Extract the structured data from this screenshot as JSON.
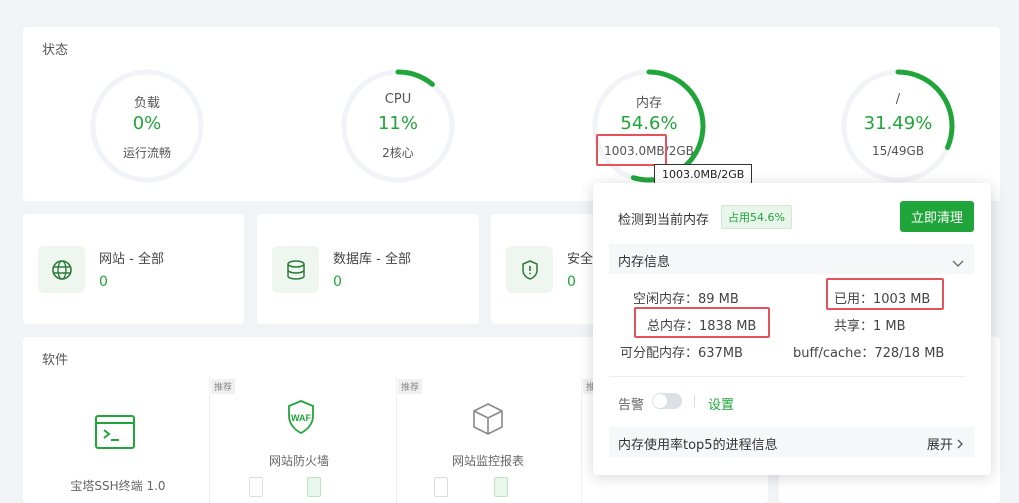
{
  "status": {
    "title": "状态",
    "gauges": [
      {
        "label": "负载",
        "value": "0%",
        "sub": "运行流畅",
        "fraction": 0.0
      },
      {
        "label": "CPU",
        "value": "11%",
        "sub": "2核心",
        "fraction": 0.11
      },
      {
        "label": "内存",
        "value": "54.6%",
        "sub": "1003.0MB/2GB",
        "fraction": 0.546
      },
      {
        "label": "/",
        "value": "31.49%",
        "sub": "15/49GB",
        "fraction": 0.3149
      }
    ],
    "tooltip": "1003.0MB/2GB",
    "accent": "#20a53a"
  },
  "cards": [
    {
      "label": "网站 - 全部",
      "value": "0",
      "icon": "globe-icon"
    },
    {
      "label": "数据库 - 全部",
      "value": "0",
      "icon": "database-icon"
    },
    {
      "label": "安全",
      "value": "0",
      "icon": "shield-icon"
    }
  ],
  "software": {
    "title": "软件",
    "tag": "推荐",
    "items": [
      {
        "name": "宝塔SSH终端 1.0",
        "icon": "terminal-icon"
      },
      {
        "name": "网站防火墙",
        "icon": "waf-icon"
      },
      {
        "name": "网站监控报表",
        "icon": "cube-icon"
      }
    ]
  },
  "memory_popup": {
    "title": "检测到当前内存",
    "badge": "占用54.6%",
    "clean_button": "立即清理",
    "section": "内存信息",
    "free": "空闲内存：89 MB",
    "used": "已用：1003 MB",
    "total": "总内存：1838 MB",
    "shared": "共享：1 MB",
    "allocatable": "可分配内存：637MB",
    "buff_cache": "buff/cache：728/18 MB",
    "alert_label": "告警",
    "settings_link": "设置",
    "top5": "内存使用率top5的进程信息",
    "expand": "展开"
  }
}
